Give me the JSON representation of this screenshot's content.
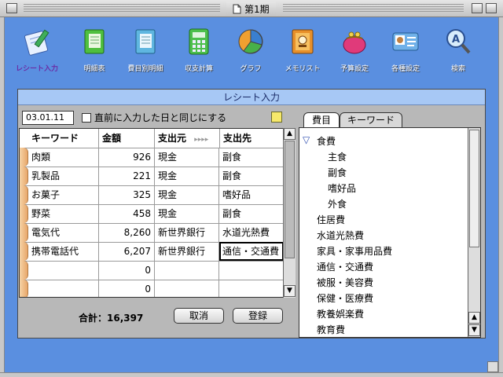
{
  "window": {
    "title": "第1期"
  },
  "toolbar": {
    "items": [
      {
        "label": "レシート入力",
        "icon": "receipt-pen-icon"
      },
      {
        "label": "明細表",
        "icon": "green-notebook-icon"
      },
      {
        "label": "費目別明細",
        "icon": "blue-notebook-icon"
      },
      {
        "label": "収支計算",
        "icon": "calculator-icon"
      },
      {
        "label": "グラフ",
        "icon": "pie-chart-icon"
      },
      {
        "label": "メモリスト",
        "icon": "memo-book-icon"
      },
      {
        "label": "予算設定",
        "icon": "purse-icon"
      },
      {
        "label": "各種設定",
        "icon": "settings-card-icon"
      },
      {
        "label": "検索",
        "icon": "magnifier-icon"
      }
    ]
  },
  "panel": {
    "title": "レシート入力"
  },
  "form": {
    "date": "03.01.11",
    "same_as_last_label": "直前に入力した日と同じにする",
    "same_as_last_checked": false
  },
  "table": {
    "headers": [
      "キーワード",
      "金額",
      "支出元",
      "▸▸▸▸",
      "支出先"
    ],
    "rows": [
      [
        "肉類",
        "926",
        "現金",
        "副食"
      ],
      [
        "乳製品",
        "221",
        "現金",
        "副食"
      ],
      [
        "お菓子",
        "325",
        "現金",
        "嗜好品"
      ],
      [
        "野菜",
        "458",
        "現金",
        "副食"
      ],
      [
        "電気代",
        "8,260",
        "新世界銀行",
        "水道光熱費"
      ],
      [
        "携帯電話代",
        "6,207",
        "新世界銀行",
        "通信・交通費"
      ],
      [
        "",
        "0",
        "",
        ""
      ],
      [
        "",
        "0",
        "",
        ""
      ]
    ]
  },
  "tabs": [
    "費目",
    "キーワード"
  ],
  "categories": [
    {
      "label": "食費",
      "expanded": true
    },
    {
      "label": "主食"
    },
    {
      "label": "副食"
    },
    {
      "label": "嗜好品"
    },
    {
      "label": "外食"
    },
    {
      "label": "住居費"
    },
    {
      "label": "水道光熱費"
    },
    {
      "label": "家具・家事用品費"
    },
    {
      "label": "通信・交通費"
    },
    {
      "label": "被服・美容費"
    },
    {
      "label": "保健・医療費"
    },
    {
      "label": "教養娯楽費"
    },
    {
      "label": "教育費"
    }
  ],
  "footer": {
    "total": "合計：16,397",
    "cancel_label": "取消",
    "register_label": "登録"
  },
  "colors": {
    "background": "#5a8fe0",
    "panel_header": "#a7c8f5",
    "active_tool": "#6a2ea6"
  }
}
